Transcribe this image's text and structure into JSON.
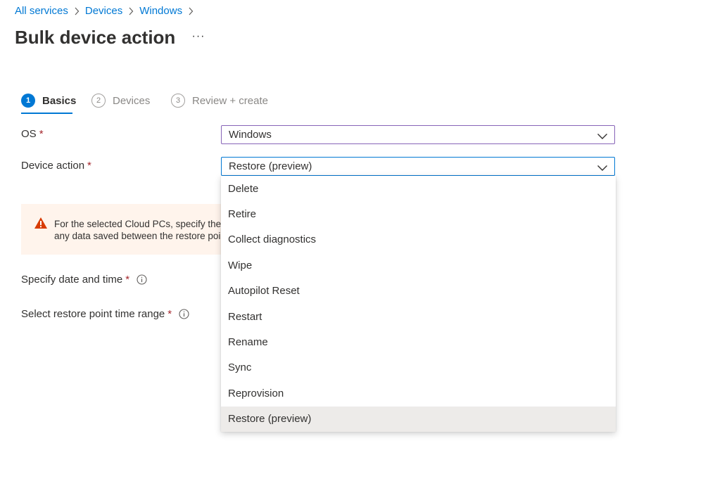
{
  "breadcrumb": {
    "items": [
      "All services",
      "Devices",
      "Windows"
    ]
  },
  "page": {
    "title": "Bulk device action",
    "more_label": "···"
  },
  "wizard": {
    "steps": [
      {
        "number": "1",
        "label": "Basics",
        "active": true
      },
      {
        "number": "2",
        "label": "Devices",
        "active": false
      },
      {
        "number": "3",
        "label": "Review + create",
        "active": false
      }
    ]
  },
  "form": {
    "os": {
      "label": "OS",
      "required": "*",
      "value": "Windows"
    },
    "device_action": {
      "label": "Device action",
      "required": "*",
      "value": "Restore (preview)"
    },
    "date_time": {
      "label": "Specify date and time",
      "required": "*"
    },
    "restore_range": {
      "label": "Select restore point time range",
      "required": "*"
    }
  },
  "warning": {
    "line1": "For the selected Cloud PCs, specify the restore point you want to restore to. Restoring will delete",
    "line2": "any data saved between the restore point and the current time."
  },
  "dropdown": {
    "options": [
      "Delete",
      "Retire",
      "Collect diagnostics",
      "Wipe",
      "Autopilot Reset",
      "Restart",
      "Rename",
      "Sync",
      "Reprovision",
      "Restore (preview)"
    ],
    "selected": "Restore (preview)"
  },
  "colors": {
    "accent": "#0078d4",
    "required": "#a4262c",
    "warning": "#d83b01",
    "warning_bg": "#fff4ec",
    "os_focus_border": "#8764b8"
  }
}
